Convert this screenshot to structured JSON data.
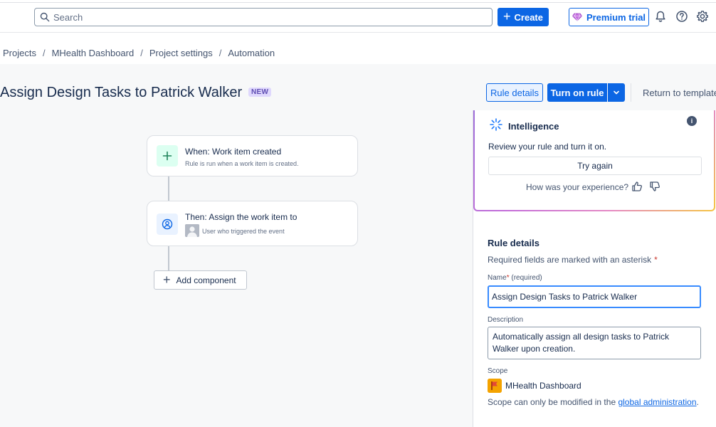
{
  "topbar": {
    "search_placeholder": "Search",
    "create_label": "Create",
    "premium_label": "Premium trial"
  },
  "breadcrumb": [
    "Projects",
    "MHealth Dashboard",
    "Project settings",
    "Automation"
  ],
  "header": {
    "title": "Assign Design Tasks to Patrick Walker",
    "badge": "NEW",
    "rule_details_label": "Rule details",
    "turn_on_label": "Turn on rule",
    "return_label": "Return to templates"
  },
  "flow": {
    "trigger": {
      "title": "When: Work item created",
      "subtitle": "Rule is run when a work item is created."
    },
    "action": {
      "title": "Then: Assign the work item to",
      "subtitle": "User who triggered the event"
    },
    "add_component_label": "Add component"
  },
  "ai_card": {
    "title": "Intelligence",
    "message": "Review your rule and turn it on.",
    "try_again_label": "Try again",
    "experience_prompt": "How was your experience?"
  },
  "rule_details": {
    "title": "Rule details",
    "required_note": "Required fields are marked with an asterisk",
    "name_label": "Name",
    "name_required": "(required)",
    "name_value": "Assign Design Tasks to Patrick Walker",
    "description_label": "Description",
    "description_value": "Automatically assign all design tasks to Patrick Walker upon creation.",
    "scope_label": "Scope",
    "scope_value": "MHealth Dashboard",
    "scope_note": "Scope can only be modified in the",
    "scope_link": "global administration",
    "scope_note_end": "."
  },
  "colors": {
    "primary": "#0c66e4",
    "badge_bg": "#dfd8fd",
    "badge_text": "#5e4db2",
    "scope_logo": "#f4a300"
  }
}
